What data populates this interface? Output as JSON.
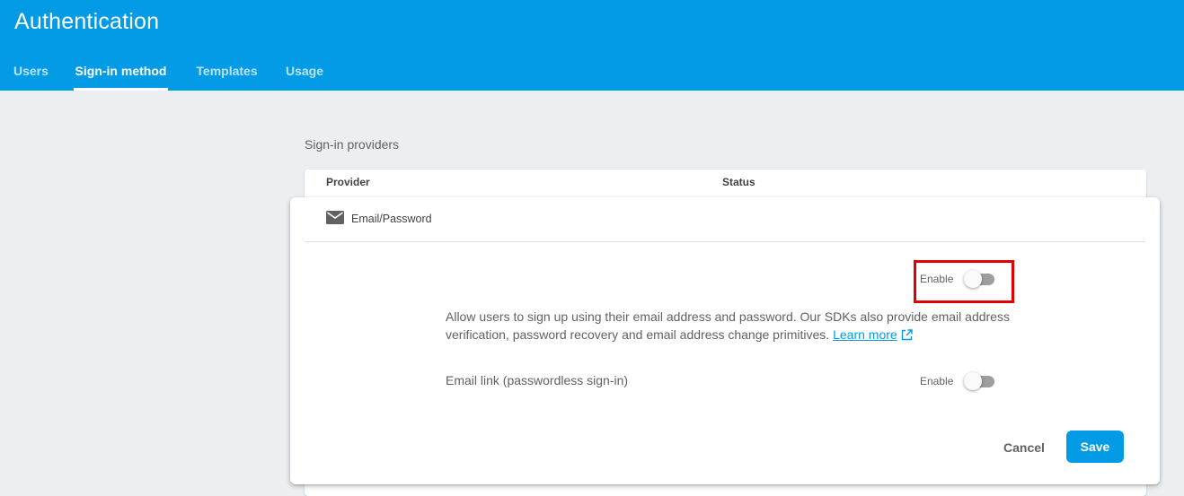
{
  "header": {
    "title": "Authentication",
    "tabs": [
      {
        "label": "Users",
        "active": false
      },
      {
        "label": "Sign-in method",
        "active": true
      },
      {
        "label": "Templates",
        "active": false
      },
      {
        "label": "Usage",
        "active": false
      }
    ]
  },
  "section": {
    "title": "Sign-in providers",
    "columns": [
      "Provider",
      "Status"
    ]
  },
  "panel": {
    "provider": {
      "name": "Email/Password",
      "icon": "mail-icon"
    },
    "enable_toggle": {
      "label": "Enable",
      "checked": false
    },
    "description": "Allow users to sign up using their email address and password. Our SDKs also provide email address verification, password recovery and email address change primitives.",
    "learn_more": "Learn more",
    "email_link": {
      "label": "Email link (passwordless sign-in)",
      "toggle_label": "Enable",
      "checked": false
    },
    "cancel_label": "Cancel",
    "save_label": "Save"
  },
  "colors": {
    "header": "#039be5",
    "accent": "#039be5",
    "highlight": "#e00000"
  }
}
